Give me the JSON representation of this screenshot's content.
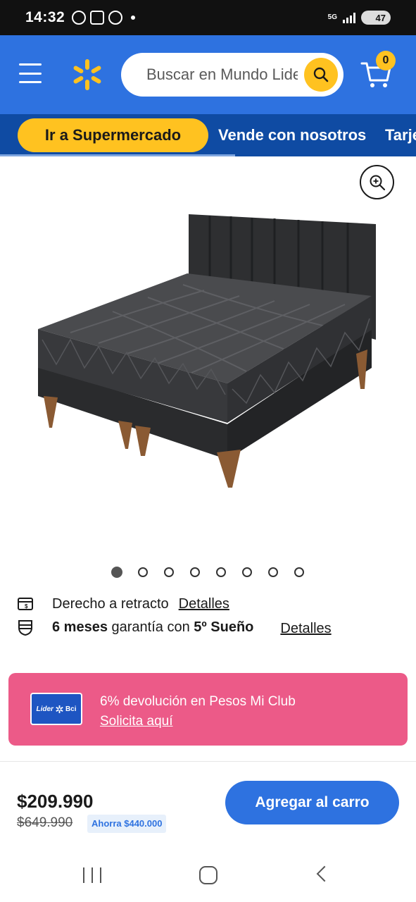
{
  "status_bar": {
    "time": "14:32",
    "network": "5G",
    "battery": "47"
  },
  "header": {
    "search": {
      "placeholder": "Buscar en Mundo Lider"
    },
    "cart_count": "0"
  },
  "subnav": {
    "supermarket_label": "Ir a Supermercado",
    "links": [
      "Vende con nosotros",
      "Tarjeta"
    ]
  },
  "product": {
    "image_dots_total": 8,
    "image_dot_active": 1
  },
  "info": {
    "retract_text": "Derecho a retracto",
    "retract_link": "Detalles",
    "warranty_bold_1": "6 meses",
    "warranty_mid": " garantía con ",
    "warranty_bold_2": "5º Sueño",
    "warranty_link": "Detalles"
  },
  "promo": {
    "card_brand_left": "Lider",
    "card_brand_right": "Bci",
    "text": "6% devolución en Pesos Mi Club",
    "link": "Solicita aquí",
    "background": "#ec5a88"
  },
  "price_bar": {
    "price": "$209.990",
    "old_price": "$649.990",
    "savings": "Ahorra $440.000",
    "add_to_cart": "Agregar al carro"
  },
  "colors": {
    "brand_blue": "#2e72e0",
    "dark_blue": "#0f4ba3",
    "brand_yellow": "#ffc220"
  }
}
